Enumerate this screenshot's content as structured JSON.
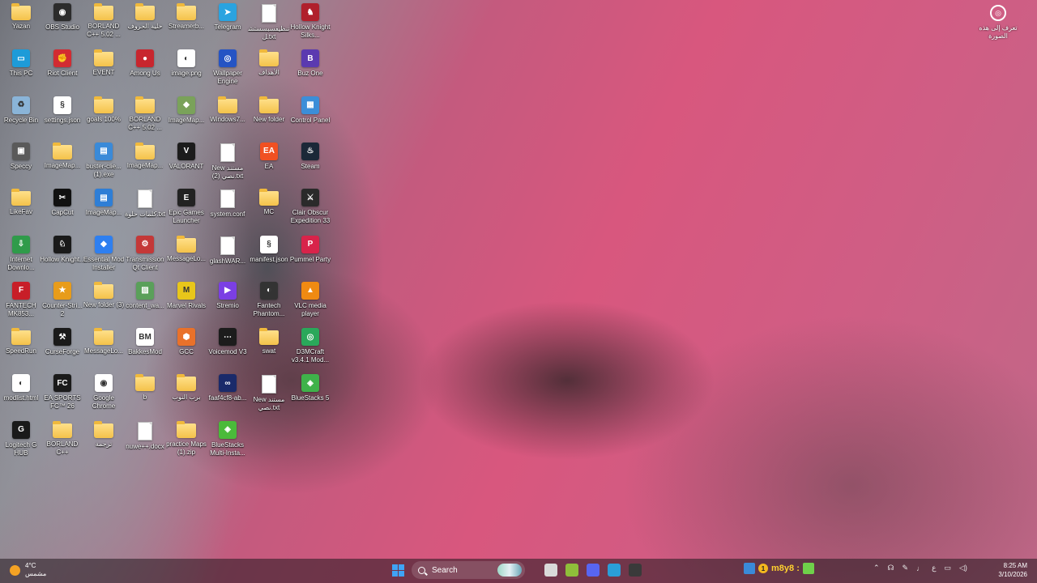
{
  "desktop": {
    "icons": [
      {
        "label": "Yazan",
        "kind": "folder"
      },
      {
        "label": "OBS Studio",
        "kind": "app",
        "color": "#2c2c2c",
        "glyph": "◉"
      },
      {
        "label": "BORLAND C++ 5.02 ...",
        "kind": "folder"
      },
      {
        "label": "خلية الحروف",
        "kind": "folder"
      },
      {
        "label": "Streamerb...",
        "kind": "folder"
      },
      {
        "label": "Telegram",
        "kind": "app",
        "color": "#2aa3e0",
        "glyph": "➤"
      },
      {
        "label": "تنظيفسبسسثشل.txt",
        "kind": "file"
      },
      {
        "label": "Hollow Knight Silks...",
        "kind": "app",
        "color": "#b0202c",
        "glyph": "♞"
      },
      {
        "label": "This PC",
        "kind": "app",
        "color": "#1d9bd8",
        "glyph": "▭"
      },
      {
        "label": "Riot Client",
        "kind": "app",
        "color": "#d22b32",
        "glyph": "✊"
      },
      {
        "label": "EVENT",
        "kind": "folder"
      },
      {
        "label": "Among Us",
        "kind": "app",
        "color": "#c8262e",
        "glyph": "●"
      },
      {
        "label": "image.png",
        "kind": "app",
        "color": "#ffffff",
        "glyph": "◐"
      },
      {
        "label": "Wallpaper Engine",
        "kind": "app",
        "color": "#2554c4",
        "glyph": "◎"
      },
      {
        "label": "الأهداف",
        "kind": "folder"
      },
      {
        "label": "Buz One",
        "kind": "app",
        "color": "#5b3ab0",
        "glyph": "B"
      },
      {
        "label": "Recycle Bin",
        "kind": "app",
        "color": "#8ab4d8",
        "glyph": "♻"
      },
      {
        "label": "settings.json",
        "kind": "app",
        "color": "#ffffff",
        "glyph": "§"
      },
      {
        "label": "goals 100%",
        "kind": "folder"
      },
      {
        "label": "BORLAND C++ 5.02 ...",
        "kind": "folder"
      },
      {
        "label": "ImageMap...",
        "kind": "app",
        "color": "#7aa25a",
        "glyph": "◆"
      },
      {
        "label": "Windows7...",
        "kind": "folder"
      },
      {
        "label": "New folder",
        "kind": "folder"
      },
      {
        "label": "Control Panel",
        "kind": "app",
        "color": "#3c8ed8",
        "glyph": "▦"
      },
      {
        "label": "Speccy",
        "kind": "app",
        "color": "#5a5a5a",
        "glyph": "▣"
      },
      {
        "label": "ImageMap...",
        "kind": "folder"
      },
      {
        "label": "buster-clie... (1).exe",
        "kind": "app",
        "color": "#3a8ad8",
        "glyph": "▤"
      },
      {
        "label": "ImageMap...",
        "kind": "folder"
      },
      {
        "label": "VALORANT",
        "kind": "app",
        "color": "#1c1c1c",
        "glyph": "V"
      },
      {
        "label": "New مستند نصي (2).txt",
        "kind": "file"
      },
      {
        "label": "EA",
        "kind": "app",
        "color": "#f05022",
        "glyph": "EA"
      },
      {
        "label": "Steam",
        "kind": "app",
        "color": "#1b2838",
        "glyph": "♨"
      },
      {
        "label": "LikeFav",
        "kind": "folder"
      },
      {
        "label": "CapCut",
        "kind": "app",
        "color": "#111111",
        "glyph": "✂"
      },
      {
        "label": "ImageMap...",
        "kind": "app",
        "color": "#2e7ed6",
        "glyph": "▤"
      },
      {
        "label": "كلمات حلوة.txt",
        "kind": "file"
      },
      {
        "label": "Epic Games Launcher",
        "kind": "app",
        "color": "#222222",
        "glyph": "E"
      },
      {
        "label": "system.conf",
        "kind": "file"
      },
      {
        "label": "MC",
        "kind": "folder"
      },
      {
        "label": "Clair Obscur Expedition 33",
        "kind": "app",
        "color": "#2a2a2a",
        "glyph": "⚔"
      },
      {
        "label": "Internet Downlo...",
        "kind": "app",
        "color": "#2f9b4a",
        "glyph": "⇩"
      },
      {
        "label": "Hollow Knight...",
        "kind": "app",
        "color": "#1a1a1a",
        "glyph": "♘"
      },
      {
        "label": "Essential Mod Installer",
        "kind": "app",
        "color": "#2e7ff0",
        "glyph": "◆"
      },
      {
        "label": "Transmission Qt Client",
        "kind": "app",
        "color": "#c43838",
        "glyph": "⚙"
      },
      {
        "label": "MessageLo...",
        "kind": "folder"
      },
      {
        "label": "glashWAR...",
        "kind": "file"
      },
      {
        "label": "manifest.json",
        "kind": "app",
        "color": "#ffffff",
        "glyph": "§"
      },
      {
        "label": "Pummel Party",
        "kind": "app",
        "color": "#d8234a",
        "glyph": "P"
      },
      {
        "label": "FANTECH MK853...",
        "kind": "app",
        "color": "#c81e28",
        "glyph": "F"
      },
      {
        "label": "Counter-Stri... 2",
        "kind": "app",
        "color": "#e89c1a",
        "glyph": "★"
      },
      {
        "label": "New folder (3)",
        "kind": "folder"
      },
      {
        "label": "content_wa...",
        "kind": "app",
        "color": "#5aa05a",
        "glyph": "▨"
      },
      {
        "label": "Marvel Rivals",
        "kind": "app",
        "color": "#e8c61a",
        "glyph": "M"
      },
      {
        "label": "Stremio",
        "kind": "app",
        "color": "#7b3fe4",
        "glyph": "▶"
      },
      {
        "label": "Fantech Phantom...",
        "kind": "app",
        "color": "#333333",
        "glyph": "◐"
      },
      {
        "label": "VLC media player",
        "kind": "app",
        "color": "#f08a12",
        "glyph": "▲"
      },
      {
        "label": "SpeedRun",
        "kind": "folder"
      },
      {
        "label": "CurseForge",
        "kind": "app",
        "color": "#1a1a1a",
        "glyph": "⚒"
      },
      {
        "label": "MessageLo...",
        "kind": "folder"
      },
      {
        "label": "BakkesMod",
        "kind": "app",
        "color": "#ffffff",
        "glyph": "BM"
      },
      {
        "label": "GCC",
        "kind": "app",
        "color": "#e9712a",
        "glyph": "⬢"
      },
      {
        "label": "Voicemod V3",
        "kind": "app",
        "color": "#1c1c1c",
        "glyph": "⋯"
      },
      {
        "label": "swat",
        "kind": "folder"
      },
      {
        "label": "D3MCraft v3.4.1 Mod...",
        "kind": "app",
        "color": "#2aa85a",
        "glyph": "◎"
      },
      {
        "label": "modlist.html",
        "kind": "app",
        "color": "#ffffff",
        "glyph": "◐"
      },
      {
        "label": "EA SPORTS FC™ 26",
        "kind": "app",
        "color": "#1a1a1a",
        "glyph": "FC"
      },
      {
        "label": "Google Chrome",
        "kind": "app",
        "color": "#ffffff",
        "glyph": "◉"
      },
      {
        "label": "b",
        "kind": "folder"
      },
      {
        "label": "برب النوب",
        "kind": "folder"
      },
      {
        "label": "faaf4cf8-ab...",
        "kind": "app",
        "color": "#1a2a6a",
        "glyph": "∞"
      },
      {
        "label": "New مستند نصي.txt",
        "kind": "file"
      },
      {
        "label": "BlueStacks 5",
        "kind": "app",
        "color": "#3fb24a",
        "glyph": "◈"
      },
      {
        "label": "Logitech G HUB",
        "kind": "app",
        "color": "#1a1a1a",
        "glyph": "G"
      },
      {
        "label": "BORLAND C++",
        "kind": "folder"
      },
      {
        "label": "ترجمة",
        "kind": "folder"
      },
      {
        "label": "nuwe++.docx",
        "kind": "file"
      },
      {
        "label": "practice Maps (1).zip",
        "kind": "folder"
      },
      {
        "label": "BlueStacks Multi-Insta...",
        "kind": "app",
        "color": "#4aba3a",
        "glyph": "◈"
      }
    ]
  },
  "screenshot_tool": {
    "label": "تعرف إلى هذه الصورة"
  },
  "taskbar": {
    "weather": {
      "temp": "4°C",
      "condition": "مشمس"
    },
    "search": {
      "placeholder": "Search"
    },
    "apps": [
      {
        "name": "file-explorer",
        "color": "#d9d9d9"
      },
      {
        "name": "xbox-app",
        "color": "#8fbf3a"
      },
      {
        "name": "discord",
        "color": "#5865f2"
      },
      {
        "name": "chrome",
        "color": "#2a9ed8"
      },
      {
        "name": "obs",
        "color": "#3a3a3a"
      }
    ],
    "tray": {
      "counter": "1",
      "user": "m8y8 :",
      "lang": "ع"
    },
    "clock": {
      "time": "8:25 AM",
      "date": "3/10/2026"
    }
  }
}
